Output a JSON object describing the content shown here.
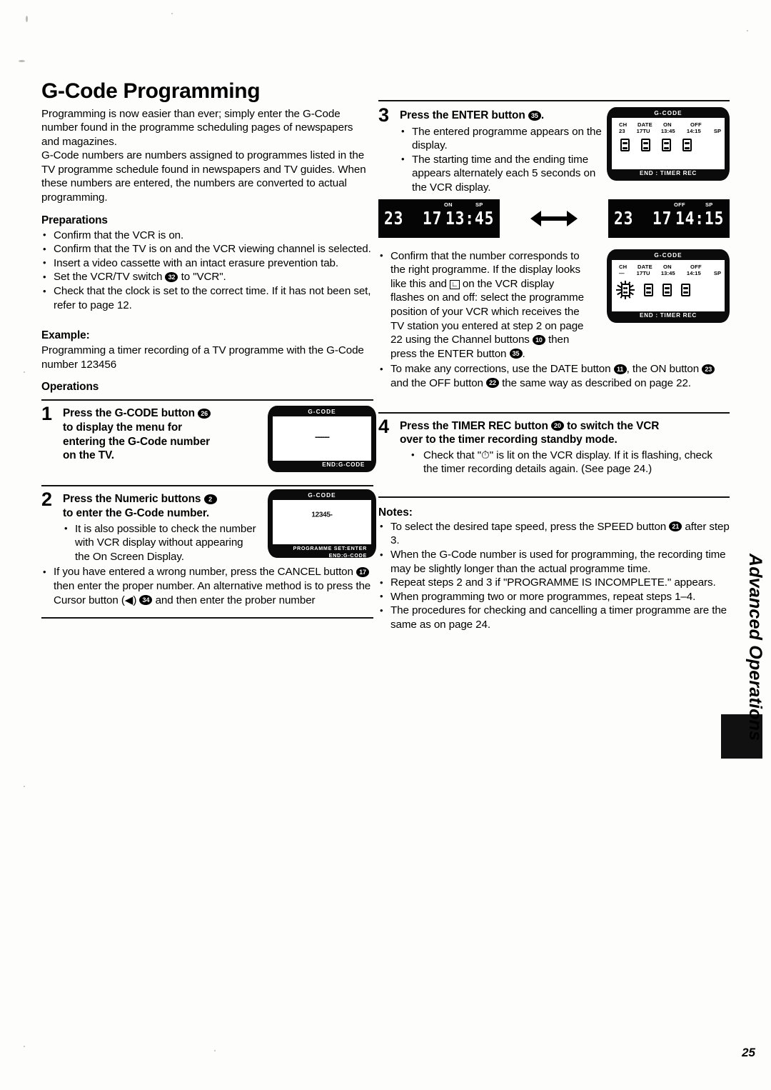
{
  "page": {
    "number": "25",
    "side_tab_label": "Advanced Operations"
  },
  "left": {
    "title": "G-Code Programming",
    "intro_paragraphs": [
      "Programming is now easier than ever; simply enter the G-Code number found in the programme scheduling pages of newspapers and magazines.",
      "G-Code numbers are numbers assigned to programmes listed in the TV programme schedule found in newspapers and TV guides. When these numbers are entered, the numbers are converted to actual programming."
    ],
    "preparations_heading": "Preparations",
    "preparations": [
      "Confirm that the VCR is on.",
      "Confirm that the TV is on and the VCR viewing channel is selected.",
      "Insert a video cassette with an intact erasure prevention tab.",
      "Set the VCR/TV switch @ to \"VCR\".",
      "Check that the clock is set to the correct time. If it has not been set, refer to page 12."
    ],
    "prep_refs": {
      "vcr_tv_switch": "32"
    },
    "example_heading": "Example:",
    "example_text": "Programming a timer recording of a TV programme with the G-Code number 123456",
    "operations_heading": "Operations",
    "steps": [
      {
        "num": "1",
        "head_lines": [
          "Press the G-CODE button",
          "to display the menu for",
          "entering the G-Code number",
          "on the TV."
        ],
        "ref": "26",
        "screen": {
          "top": "G-CODE",
          "center": "------",
          "bottom": "END:G-CODE"
        }
      },
      {
        "num": "2",
        "head_lines": [
          "Press the Numeric buttons",
          "to enter the G-Code number."
        ],
        "ref": "2",
        "bullets": [
          "It is also possible to check the number with VCR display without appearing the On Screen Display.",
          "If you have entered a wrong number, press the CANCEL button ⓪ then enter the proper number. An alternative method is to press the Cursor button (◀) ⓪ and then enter the prober number"
        ],
        "bullet_refs": {
          "cancel": "17",
          "cursor": "34"
        },
        "screen": {
          "top": "G-CODE",
          "center": "12345-",
          "bottom_line1": "PROGRAMME SET:ENTER",
          "bottom_line2": "END:G-CODE"
        }
      }
    ]
  },
  "right": {
    "step3": {
      "num": "3",
      "head": "Press the ENTER button",
      "ref": "35",
      "head_suffix": ".",
      "bullets": [
        "The entered programme appears on the display.",
        "The starting time and the ending time appears alternately each 5 seconds on the VCR display."
      ],
      "screen_top": {
        "top": "G-CODE",
        "headers": [
          "CH",
          "DATE",
          "ON",
          "OFF"
        ],
        "values": [
          "23",
          "17TU",
          "13:45",
          "14:15"
        ],
        "speed": "SP",
        "bottom": "END : TIMER REC"
      },
      "vcr_displays": [
        {
          "label_1": "ON",
          "label_2": "SP",
          "channel": "23",
          "date": "17",
          "time": "13:45"
        },
        {
          "label_1": "OFF",
          "label_2": "SP",
          "channel": "23",
          "date": "17",
          "time": "14:15"
        }
      ],
      "bullets2": [
        "Confirm that the number corresponds to the right programme. If the display looks like this and ⏱ on the VCR display flashes on and off: select the programme position of your VCR which receives the TV station you entered at step 2 on page 22 using the Channel buttons ⓪ then press the ENTER button ⓪.",
        "To make any corrections, use the DATE button ⓪, the ON button ⓪ and the OFF button ⓪ the same way as described on page 22."
      ],
      "bullet2_refs": {
        "channel": "10",
        "enter": "35",
        "date": "11",
        "on": "23",
        "off": "22"
      },
      "screen_bottom": {
        "top": "G-CODE",
        "headers": [
          "CH",
          "DATE",
          "ON",
          "OFF"
        ],
        "values": [
          "—",
          "17TU",
          "13:45",
          "14:15"
        ],
        "speed": "SP",
        "bottom": "END : TIMER REC"
      }
    },
    "step4": {
      "num": "4",
      "head_line1": "Press the TIMER REC button",
      "ref": "20",
      "head_line1b": "to switch the VCR",
      "head_line2": "over to the timer recording standby mode.",
      "bullets": [
        "Check that \"⏱\" is lit on the VCR display. If it is flashing, check the timer recording details again. (See page 24.)"
      ]
    },
    "notes_heading": "Notes:",
    "notes": [
      "To select the desired tape speed, press the SPEED button ⓪ after step 3.",
      "When the G-Code number is used for programming, the recording time may be slightly longer than the actual programme time.",
      "Repeat steps 2 and 3 if \"PROGRAMME IS INCOMPLETE.\" appears.",
      "When programming two or more programmes, repeat steps 1–4.",
      "The procedures for checking and cancelling a timer programme are the same as on page 24."
    ],
    "note_refs": {
      "speed": "21"
    }
  }
}
